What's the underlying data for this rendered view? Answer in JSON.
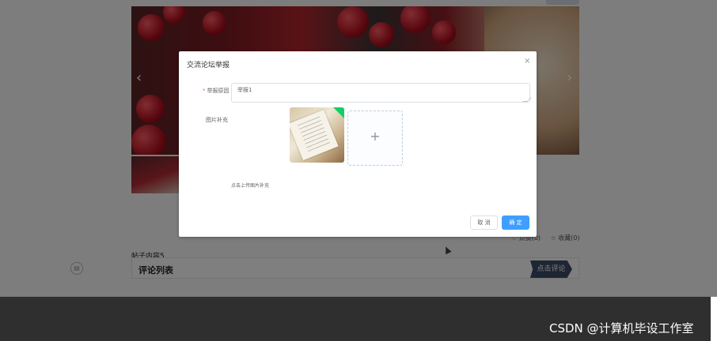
{
  "background": {
    "hero_prev_icon": "‹",
    "hero_next_icon": "›",
    "stats": {
      "like_label": "♡ 点赞(0)",
      "collect_label": "☆ 收藏(0)"
    },
    "post_title": "帖子内容5",
    "comment_list_title": "评论列表",
    "comment_button": "点击评论",
    "side_icon": "▤",
    "watermark": "CSDN @计算机毕设工作室"
  },
  "dialog": {
    "title": "交流论坛举报",
    "close_icon": "×",
    "reason_label": "举报原因",
    "required_mark": "*",
    "reason_value": "举报1",
    "image_label": "图片补充",
    "upload_plus": "+",
    "upload_tip": "点击上传图片补充",
    "cancel_label": "取 消",
    "confirm_label": "确 定"
  },
  "colors": {
    "primary": "#409eff",
    "overlay": "rgba(0,0,0,0.5)",
    "comment_button_bg": "#3d4b66",
    "footer_bg": "#2f2f2f"
  }
}
